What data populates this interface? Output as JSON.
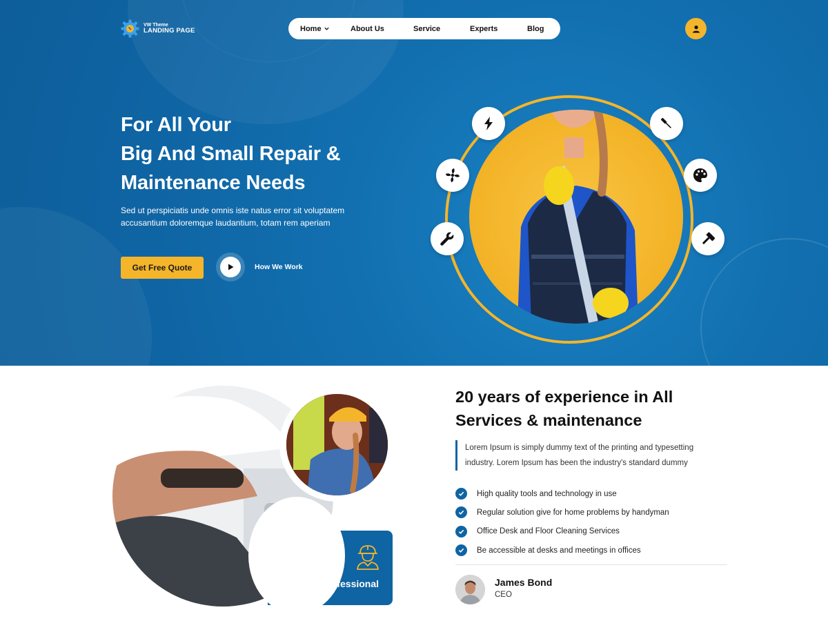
{
  "brand": {
    "small": "VW Theme",
    "name": "LANDING PAGE"
  },
  "nav": {
    "items": [
      {
        "label": "Home",
        "has_dropdown": true
      },
      {
        "label": "About Us"
      },
      {
        "label": "Service"
      },
      {
        "label": "Experts"
      },
      {
        "label": "Blog"
      }
    ]
  },
  "hero": {
    "title_lines": [
      "For All Your",
      "Big And Small Repair &",
      "Maintenance Needs"
    ],
    "description_lines": [
      "Sed ut perspiciatis unde omnis iste natus error sit voluptatem",
      "accusantium doloremque laudantium, totam rem aperiam"
    ],
    "cta_label": "Get Free Quote",
    "video_label": "How We Work",
    "tool_icons": [
      "lightning-icon",
      "screwdriver-icon",
      "fan-icon",
      "palette-icon",
      "wrench-icon",
      "hammer-icon"
    ]
  },
  "about": {
    "title_lines": [
      "20 years of experience in All",
      "Services & maintenance"
    ],
    "quote_lines": [
      "Lorem Ipsum is simply dummy text of the printing and typesetting",
      "industry. Lorem Ipsum has been the industry's standard dummy"
    ],
    "features": [
      "High quality tools and technology in use",
      "Regular solution give for home problems by handyman",
      "Office Desk and Floor Cleaning Services",
      "Be accessible at desks and meetings in offices"
    ],
    "badge_label": "Professional",
    "author": {
      "name": "James Bond",
      "role": "CEO"
    }
  },
  "colors": {
    "primary": "#0f64a3",
    "accent": "#f4b52a",
    "white": "#ffffff"
  }
}
